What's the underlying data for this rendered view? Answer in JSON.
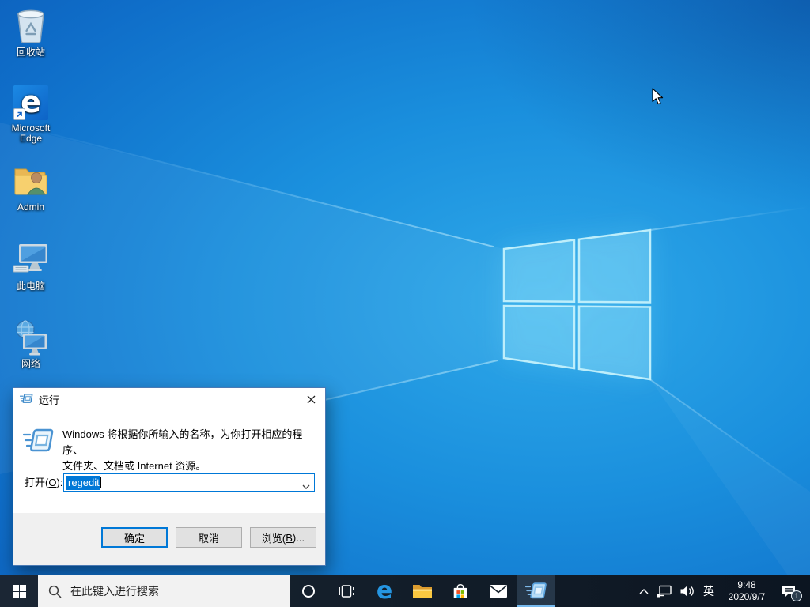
{
  "desktop": {
    "icons": [
      {
        "label": "回收站"
      },
      {
        "label": "Microsoft Edge"
      },
      {
        "label": "Admin"
      },
      {
        "label": "此电脑"
      },
      {
        "label": "网络"
      }
    ]
  },
  "icons": {
    "edge_glyph": "e"
  },
  "run_dialog": {
    "title": "运行",
    "description_line1": "Windows 将根据你所输入的名称，为你打开相应的程序、",
    "description_line2": "文件夹、文档或 Internet 资源。",
    "open_label": {
      "prefix": "打开(",
      "mnemonic": "O",
      "suffix": "):"
    },
    "input_value": "regedit",
    "buttons": {
      "ok": "确定",
      "cancel": "取消",
      "browse": {
        "prefix": "浏览(",
        "mnemonic": "B",
        "suffix": ")..."
      }
    }
  },
  "taskbar": {
    "search_placeholder": "在此键入进行搜索",
    "tray": {
      "ime": "英",
      "time": "9:48",
      "date": "2020/9/7",
      "notification_count": "1"
    }
  },
  "colors": {
    "accent": "#0078d7",
    "taskbar_bg": "#131e2a",
    "wallpaper_primary": "#1a8fdd",
    "selection": "#0078d7"
  }
}
